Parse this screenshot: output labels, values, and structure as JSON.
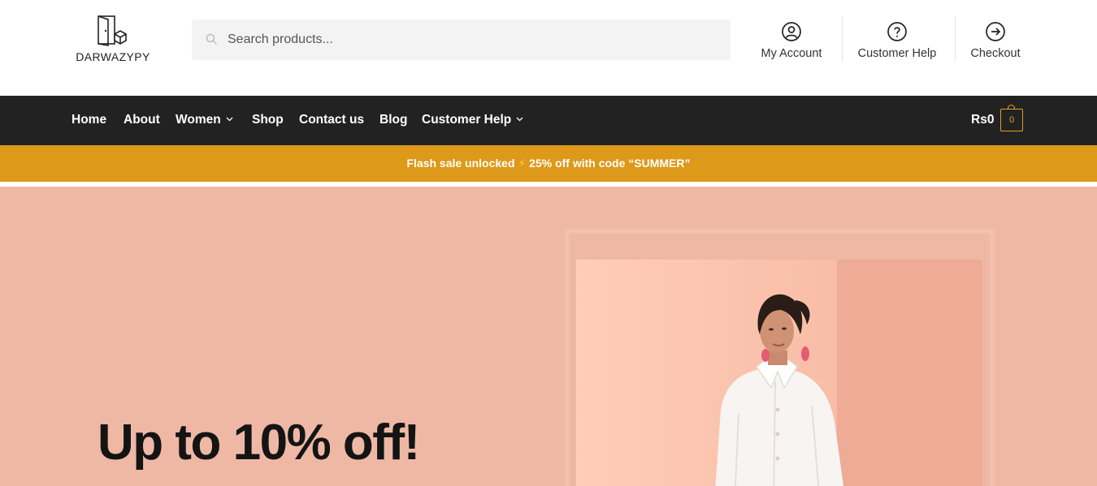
{
  "brand": {
    "name": "DARWAZYPY"
  },
  "search": {
    "placeholder": "Search products..."
  },
  "header_links": [
    {
      "label": "My Account",
      "icon": "user-circle-icon"
    },
    {
      "label": "Customer Help",
      "icon": "question-circle-icon"
    },
    {
      "label": "Checkout",
      "icon": "arrow-right-circle-icon"
    }
  ],
  "nav": {
    "items": [
      {
        "label": "Home"
      },
      {
        "label": "About"
      },
      {
        "label": "Women",
        "has_dropdown": true
      },
      {
        "label": "Shop"
      },
      {
        "label": "Contact us"
      },
      {
        "label": "Blog"
      },
      {
        "label": "Customer Help",
        "has_dropdown": true
      }
    ],
    "cart_total": "Rs0",
    "cart_count": "0"
  },
  "flash": {
    "before": "Flash sale unlocked",
    "icon": "⚡",
    "after": "25% off with code “SUMMER”"
  },
  "hero": {
    "title": "Up to 10% off!"
  },
  "colors": {
    "nav_bg": "#222222",
    "flash_bg": "#dd9919",
    "hero_bg": "#efb8a5",
    "accent": "#e0a11d"
  }
}
